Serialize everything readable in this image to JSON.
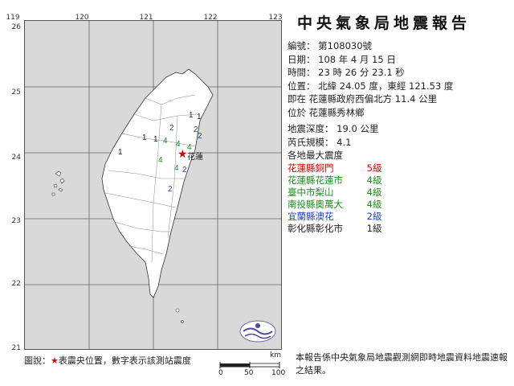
{
  "report": {
    "title": "中央氣象局地震報告",
    "number": "編號：  第108030號",
    "date": "日期：  108  年  4  月  15  日",
    "time": "時間：  23  時  26  分  23.1  秒",
    "position": "位置：  北緯  24.05  度，東經  121.53  度",
    "relative": "即在  花蓮縣政府西偏北方  11.4  公里",
    "located": "位於  花蓮縣秀林鄉",
    "depth": "地震深度：  19.0  公里",
    "magnitude": "芮氏規模：  4.1",
    "intensity_header": "各地最大震度",
    "intensities": [
      {
        "location": "花蓮縣銅門",
        "level": "5級",
        "color": "#e00000"
      },
      {
        "location": "花蓮縣花蓮市",
        "level": "4級",
        "color": "#1a8f1a"
      },
      {
        "location": "臺中市梨山",
        "level": "4級",
        "color": "#1a8f1a"
      },
      {
        "location": "南投縣奧萬大",
        "level": "4級",
        "color": "#1a8f1a"
      },
      {
        "location": "宜蘭縣澳花",
        "level": "2級",
        "color": "#1f3fbf"
      },
      {
        "location": "彰化縣彰化市",
        "level": "1級",
        "color": "#222222"
      }
    ]
  },
  "map": {
    "lon_labels": [
      "119",
      "120",
      "121",
      "122",
      "123"
    ],
    "lat_labels": [
      "26",
      "25",
      "24",
      "23",
      "22",
      "21"
    ],
    "city_label": "花蓮",
    "station_marks": [
      {
        "value": "1",
        "color": "#222222"
      },
      {
        "value": "1",
        "color": "#222222"
      },
      {
        "value": "2",
        "color": "#1f3fbf"
      },
      {
        "value": "2",
        "color": "#1f3fbf"
      },
      {
        "value": "2",
        "color": "#1f3fbf"
      },
      {
        "value": "1",
        "color": "#222222"
      },
      {
        "value": "1",
        "color": "#222222"
      },
      {
        "value": "1",
        "color": "#222222"
      },
      {
        "value": "4",
        "color": "#1a8f1a"
      },
      {
        "value": "4",
        "color": "#1a8f1a"
      },
      {
        "value": "4",
        "color": "#1a8f1a"
      },
      {
        "value": "4",
        "color": "#1a8f1a"
      },
      {
        "value": "4",
        "color": "#1a8f1a"
      },
      {
        "value": "2",
        "color": "#1f3fbf"
      },
      {
        "value": "2",
        "color": "#1f3fbf"
      }
    ]
  },
  "footer": {
    "legend_prefix": "圖說：",
    "legend_star": "★",
    "legend_text": "表震央位置，數字表示該測站震度",
    "note": "本報告係中央氣象局地震觀測網即時地震資料地震速報之結果。",
    "scale_unit": "km",
    "scale_ticks": [
      "0",
      "50",
      "100"
    ]
  },
  "colors": {
    "epicenter": "#e00000",
    "sea": "#d9d9d9",
    "land": "#ffffff"
  }
}
